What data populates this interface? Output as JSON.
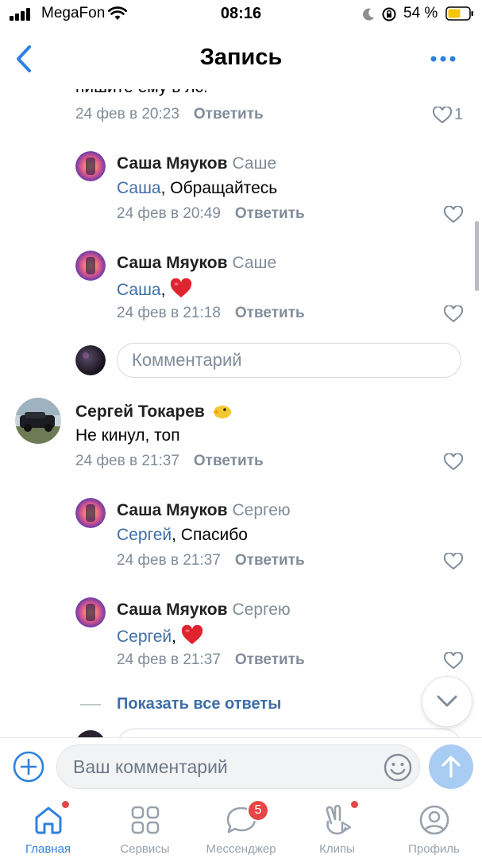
{
  "status_bar": {
    "carrier": "MegaFon",
    "time": "08:16",
    "battery": "54 %"
  },
  "header": {
    "title": "Запись"
  },
  "top_comment": {
    "partial_text": "пишите ему в лс!",
    "date": "24 фев в 20:23",
    "reply_label": "Ответить",
    "likes": "1"
  },
  "comments": [
    {
      "author": "Саша Мяуков",
      "to": "Саше",
      "mention": "Саша",
      "text": ", Обращайтесь",
      "date": "24 фев в 20:49",
      "reply_label": "Ответить"
    },
    {
      "author": "Саша Мяуков",
      "to": "Саше",
      "mention": "Саша",
      "text": ", ",
      "date": "24 фев в 21:18",
      "reply_label": "Ответить"
    },
    {
      "author": "Сергей Токарев",
      "text": "Не кинул, топ",
      "date": "24 фев в 21:37",
      "reply_label": "Ответить"
    },
    {
      "author": "Саша Мяуков",
      "to": "Сергею",
      "mention": "Сергей",
      "text": ", Спасибо",
      "date": "24 фев в 21:37",
      "reply_label": "Ответить"
    },
    {
      "author": "Саша Мяуков",
      "to": "Сергею",
      "mention": "Сергей",
      "text": ", ",
      "date": "24 фев в 21:37",
      "reply_label": "Ответить"
    }
  ],
  "reply_field": {
    "placeholder": "Комментарий"
  },
  "show_all_replies": "Показать все ответы",
  "comment_bar": {
    "placeholder": "Ваш комментарий"
  },
  "tabs": [
    {
      "label": "Главная",
      "icon": "home-icon",
      "active": true
    },
    {
      "label": "Сервисы",
      "icon": "services-icon"
    },
    {
      "label": "Мессенджер",
      "icon": "messenger-icon",
      "badge": "5"
    },
    {
      "label": "Клипы",
      "icon": "clips-icon"
    },
    {
      "label": "Профиль",
      "icon": "profile-icon"
    }
  ],
  "colors": {
    "accent": "#2d81e0",
    "link": "#3e6ea7",
    "secondary_text": "#818c99",
    "badge": "#e64646"
  }
}
